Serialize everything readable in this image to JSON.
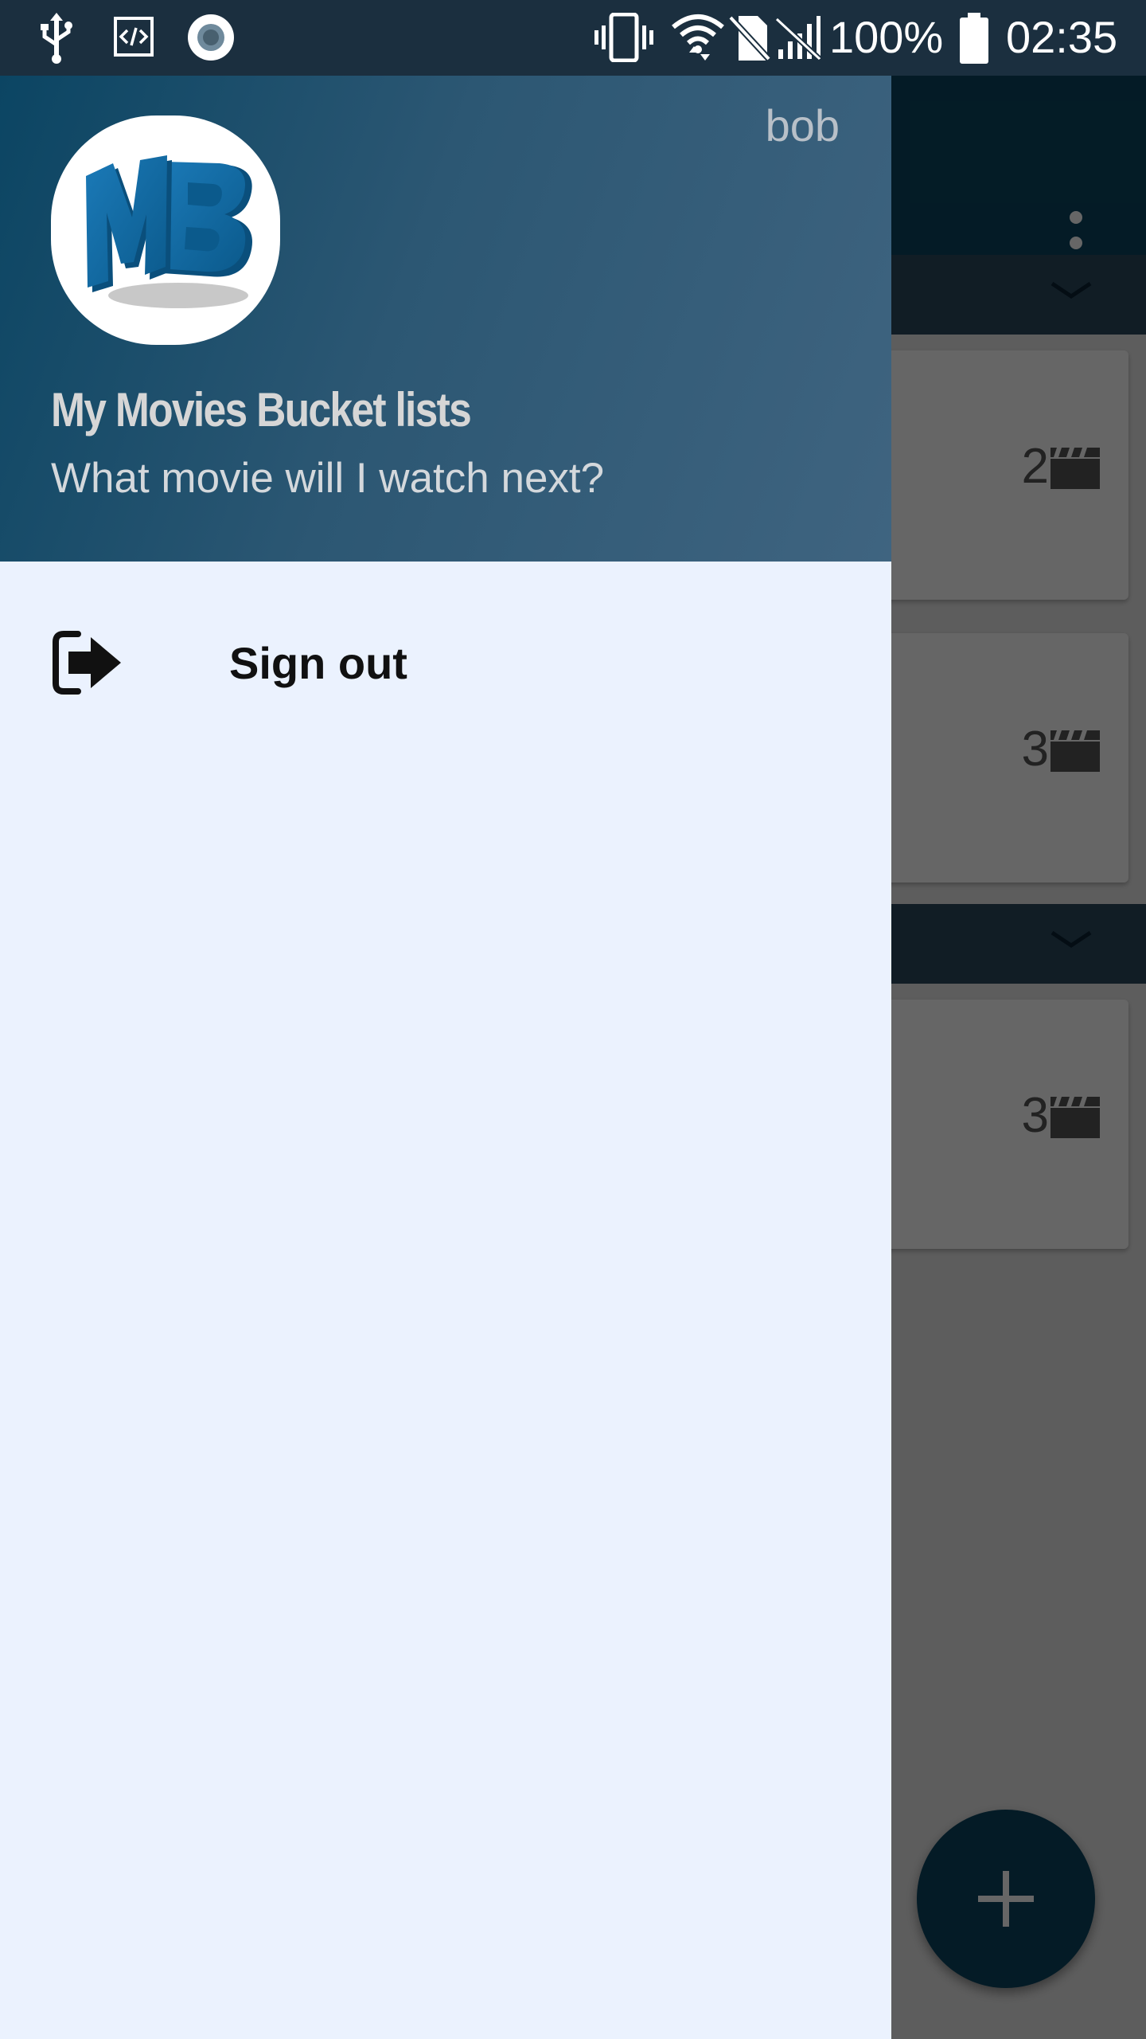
{
  "status_bar": {
    "battery": "100%",
    "time": "02:35",
    "icons": [
      "usb-icon",
      "developer-mode-icon",
      "record-icon",
      "vibrate-icon",
      "wifi-icon",
      "no-sim-icon",
      "no-signal-icon",
      "battery-full-icon"
    ]
  },
  "drawer": {
    "username": "bob",
    "app_title": "My Movies Bucket lists",
    "app_subtitle": "What movie will I watch next?",
    "logo_icon": "mb-logo",
    "menu": [
      {
        "label": "Sign out",
        "icon": "sign-out-icon"
      }
    ]
  },
  "background_app": {
    "toolbar_menu_icon": "more-vert-icon",
    "section_toggle_icon": "chevron-down-icon",
    "cards": [
      {
        "count": "2",
        "icon": "movie-clapper-icon"
      },
      {
        "count": "3",
        "icon": "movie-clapper-icon"
      },
      {
        "count": "3",
        "icon": "movie-clapper-icon"
      }
    ],
    "fab_icon": "add-icon"
  },
  "colors": {
    "primary": "#0b4560",
    "drawer_background": "#ebf2fe",
    "status_bar": "#1b2f3f"
  }
}
